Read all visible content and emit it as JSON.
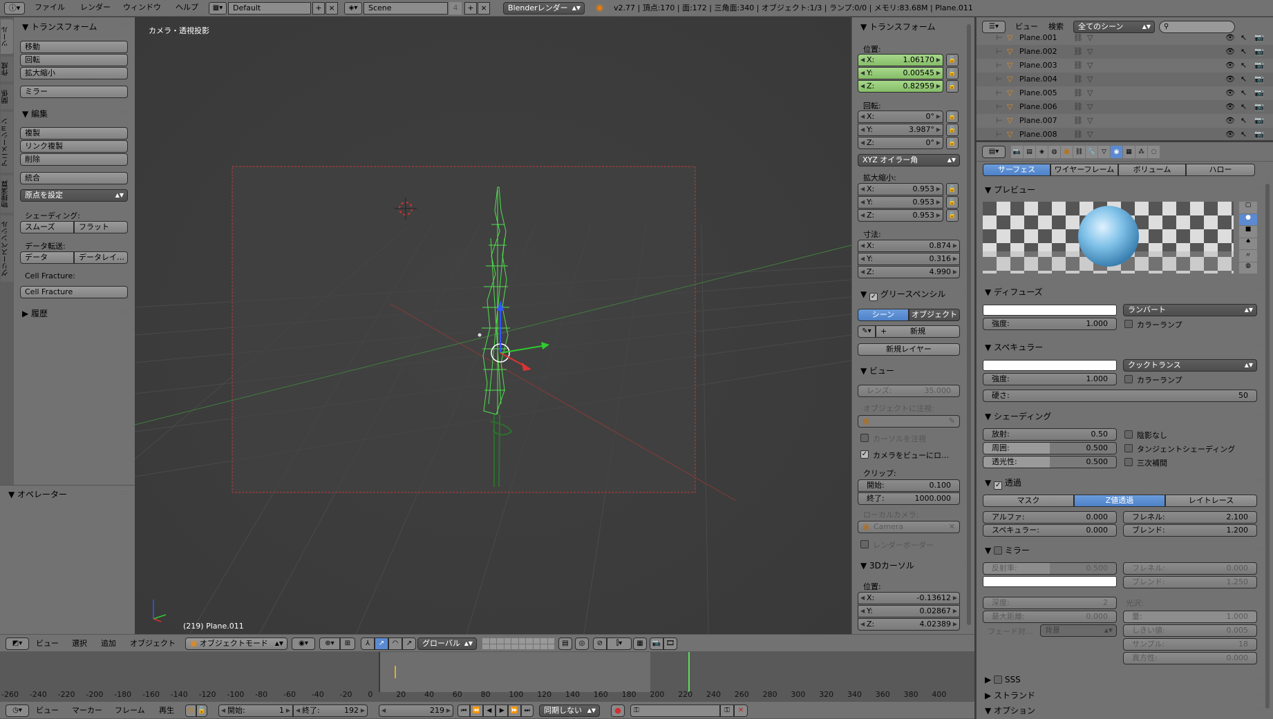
{
  "topbar": {
    "menus": [
      "ファイル",
      "レンダー",
      "ウィンドウ",
      "ヘルプ"
    ],
    "layout": "Default",
    "scene": "Scene",
    "scene_users": "4",
    "engine": "Blenderレンダー",
    "stats": "v2.77 | 頂点:170 | 面:172 | 三角面:340 | オブジェクト:1/3 | ランプ:0/0 | メモリ:83.68M | Plane.011"
  },
  "toolshelf": {
    "tabs": [
      "ツール",
      "作成",
      "関係",
      "アニメーション",
      "物理演算",
      "グリースペンシル"
    ],
    "transform": {
      "title": "トランスフォーム",
      "buttons": [
        "移動",
        "回転",
        "拡大縮小",
        "ミラー"
      ]
    },
    "edit": {
      "title": "編集",
      "buttons": [
        "複製",
        "リンク複製",
        "削除",
        "統合"
      ],
      "set_origin": "原点を設定",
      "shading_label": "シェーディング:",
      "smooth": "スムーズ",
      "flat": "フラット",
      "data_transfer_label": "データ転送:",
      "data": "データ",
      "data_layer": "データレイ…",
      "cell_fracture_label": "Cell Fracture:",
      "cell_fracture": "Cell Fracture"
    },
    "history": {
      "title": "履歴"
    },
    "operator": {
      "title": "オペレーター"
    }
  },
  "viewport": {
    "title": "カメラ・透視投影",
    "object_label": "(219) Plane.011"
  },
  "npanel": {
    "transform": {
      "title": "トランスフォーム",
      "location_label": "位置:",
      "location": [
        {
          "l": "X:",
          "v": "1.06170"
        },
        {
          "l": "Y:",
          "v": "0.00545"
        },
        {
          "l": "Z:",
          "v": "0.82959"
        }
      ],
      "rotation_label": "回転:",
      "rotation": [
        {
          "l": "X:",
          "v": "0°"
        },
        {
          "l": "Y:",
          "v": "3.987°"
        },
        {
          "l": "Z:",
          "v": "0°"
        }
      ],
      "rotation_mode": "XYZ オイラー角",
      "scale_label": "拡大縮小:",
      "scale": [
        {
          "l": "X:",
          "v": "0.953"
        },
        {
          "l": "Y:",
          "v": "0.953"
        },
        {
          "l": "Z:",
          "v": "0.953"
        }
      ],
      "dimensions_label": "寸法:",
      "dimensions": [
        {
          "l": "X:",
          "v": "0.874"
        },
        {
          "l": "Y:",
          "v": "0.316"
        },
        {
          "l": "Z:",
          "v": "4.990"
        }
      ]
    },
    "grease": {
      "title": "グリースペンシル",
      "scene": "シーン",
      "object": "オブジェクト",
      "new": "新規",
      "new_layer": "新規レイヤー"
    },
    "view": {
      "title": "ビュー",
      "lens": "レンズ:",
      "lens_value": "35.000",
      "lock_object": "オブジェクトに注視:",
      "lock_cursor": "カーソルを注視",
      "lock_camera": "カメラをビューにロ…",
      "clip_label": "クリップ:",
      "clip_start_l": "開始:",
      "clip_start": "0.100",
      "clip_end_l": "終了:",
      "clip_end": "1000.000",
      "local_camera": "ローカルカメラ:",
      "camera": "Camera",
      "render_border": "レンダーボーダー"
    },
    "cursor": {
      "title": "3Dカーソル",
      "location_label": "位置:",
      "location": [
        {
          "l": "X:",
          "v": "-0.13612"
        },
        {
          "l": "Y:",
          "v": "0.02867"
        },
        {
          "l": "Z:",
          "v": "4.02389"
        }
      ]
    }
  },
  "viewheader": {
    "menus": [
      "ビュー",
      "選択",
      "追加",
      "オブジェクト"
    ],
    "mode": "オブジェクトモード",
    "orientation": "グローバル"
  },
  "timeline": {
    "ticks": [
      "-260",
      "-240",
      "-220",
      "-200",
      "-180",
      "-160",
      "-140",
      "-120",
      "-100",
      "-80",
      "-60",
      "-40",
      "-20",
      "0",
      "20",
      "40",
      "60",
      "80",
      "100",
      "120",
      "140",
      "160",
      "180",
      "200",
      "220",
      "240",
      "260",
      "280",
      "300",
      "320",
      "340",
      "360",
      "380",
      "400"
    ],
    "menus": [
      "ビュー",
      "マーカー",
      "フレーム",
      "再生"
    ],
    "start_l": "開始:",
    "start": "1",
    "end_l": "終了:",
    "end": "192",
    "current": "219",
    "sync": "同期しない"
  },
  "outliner": {
    "menus": [
      "ビュー",
      "検索"
    ],
    "filter": "全てのシーン",
    "items": [
      "Plane.001",
      "Plane.002",
      "Plane.003",
      "Plane.004",
      "Plane.005",
      "Plane.006",
      "Plane.007",
      "Plane.008"
    ]
  },
  "properties": {
    "tabs": [
      "サーフェス",
      "ワイヤーフレーム",
      "ボリューム",
      "ハロー"
    ],
    "preview": {
      "title": "プレビュー"
    },
    "diffuse": {
      "title": "ディフューズ",
      "shader": "ランバート",
      "intensity_l": "強度:",
      "intensity": "1.000",
      "ramp": "カラーランプ"
    },
    "specular": {
      "title": "スペキュラー",
      "shader": "クックトランス",
      "intensity_l": "強度:",
      "intensity": "1.000",
      "ramp": "カラーランプ",
      "hardness_l": "硬さ:",
      "hardness": "50"
    },
    "shading": {
      "title": "シェーディング",
      "emit_l": "放射:",
      "emit": "0.50",
      "ambient_l": "周囲:",
      "ambient": "0.500",
      "translucency_l": "透光性:",
      "translucency": "0.500",
      "shadeless": "陰影なし",
      "tangent": "タンジェントシェーディング",
      "cubic": "三次補間"
    },
    "transparency": {
      "title": "透過",
      "modes": [
        "マスク",
        "Z値透過",
        "レイトレース"
      ],
      "alpha_l": "アルファ:",
      "alpha": "0.000",
      "fresnel_l": "フレネル:",
      "fresnel": "2.100",
      "specular_l": "スペキュラー:",
      "specular": "0.000",
      "blend_l": "ブレンド:",
      "blend": "1.200"
    },
    "mirror": {
      "title": "ミラー",
      "reflect_l": "反射率:",
      "reflect": "0.500",
      "fresnel_l": "フレネル:",
      "fresnel": "0.000",
      "blend_l": "ブレンド:",
      "blend": "1.250",
      "depth_l": "深度:",
      "depth": "2",
      "maxdist_l": "最大距離:",
      "maxdist": "0.000",
      "gloss_label": "光沢:",
      "amount_l": "量:",
      "amount": "1.000",
      "threshold_l": "しきい値:",
      "threshold": "0.005",
      "samples_l": "サンプル:",
      "samples": "18",
      "aniso_l": "異方性:",
      "aniso": "0.000",
      "fade_l": "フェード対…",
      "fade": "背景"
    },
    "sss": "SSS",
    "strand": "ストランド",
    "options": "オプション"
  }
}
